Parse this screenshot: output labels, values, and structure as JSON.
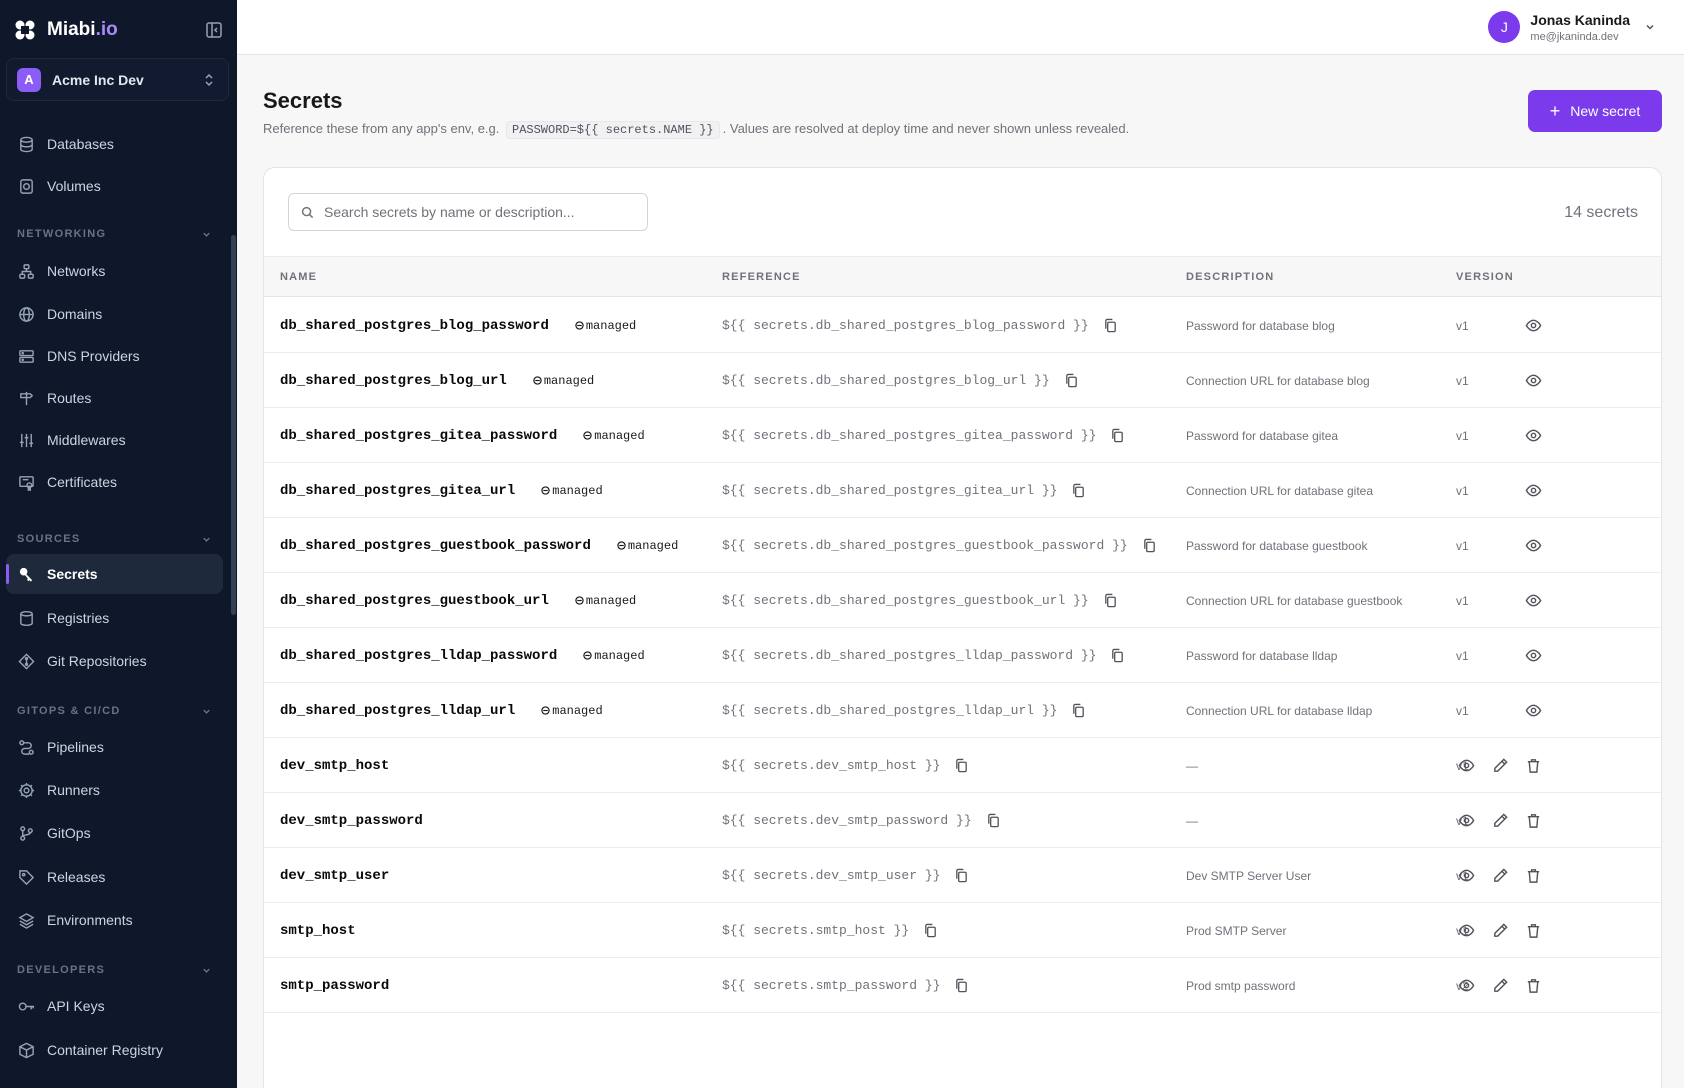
{
  "brand": {
    "name": "Miabi",
    "tld": ".io"
  },
  "org": {
    "initial": "A",
    "name": "Acme Inc Dev"
  },
  "sidebar": {
    "storage": [
      {
        "label": "Databases",
        "icon": "database-icon"
      },
      {
        "label": "Volumes",
        "icon": "volume-icon"
      }
    ],
    "sections": [
      {
        "title": "NETWORKING",
        "items": [
          {
            "label": "Networks",
            "icon": "network-icon"
          },
          {
            "label": "Domains",
            "icon": "globe-icon"
          },
          {
            "label": "DNS Providers",
            "icon": "server-icon"
          },
          {
            "label": "Routes",
            "icon": "signpost-icon"
          },
          {
            "label": "Middlewares",
            "icon": "sliders-icon"
          },
          {
            "label": "Certificates",
            "icon": "certificate-icon"
          }
        ]
      },
      {
        "title": "SOURCES",
        "items": [
          {
            "label": "Secrets",
            "icon": "key-icon",
            "active": true
          },
          {
            "label": "Registries",
            "icon": "registry-icon"
          },
          {
            "label": "Git Repositories",
            "icon": "git-icon"
          }
        ]
      },
      {
        "title": "GITOPS & CI/CD",
        "items": [
          {
            "label": "Pipelines",
            "icon": "pipeline-icon"
          },
          {
            "label": "Runners",
            "icon": "cog-icon"
          },
          {
            "label": "GitOps",
            "icon": "git-branch-icon"
          },
          {
            "label": "Releases",
            "icon": "tag-icon"
          },
          {
            "label": "Environments",
            "icon": "layers-icon"
          }
        ]
      },
      {
        "title": "DEVELOPERS",
        "items": [
          {
            "label": "API Keys",
            "icon": "key-round-icon"
          },
          {
            "label": "Container Registry",
            "icon": "box-icon"
          }
        ]
      }
    ]
  },
  "user": {
    "initial": "J",
    "name": "Jonas Kaninda",
    "email": "me@jkaninda.dev"
  },
  "page": {
    "title": "Secrets",
    "subtitle_before": "Reference these from any app's env, e.g.",
    "subtitle_code": "PASSWORD=${{ secrets.NAME }}",
    "subtitle_after": ". Values are resolved at deploy time and never shown unless revealed.",
    "new_button": "New secret"
  },
  "search": {
    "placeholder": "Search secrets by name or description..."
  },
  "count": "14 secrets",
  "table": {
    "headers": {
      "name": "NAME",
      "reference": "REFERENCE",
      "description": "DESCRIPTION",
      "version": "VERSION"
    },
    "badge_label": "managed",
    "rows": [
      {
        "name": "db_shared_postgres_blog_password",
        "managed": true,
        "reference": "${{ secrets.db_shared_postgres_blog_password }}",
        "description": "Password for database blog",
        "version": "v1"
      },
      {
        "name": "db_shared_postgres_blog_url",
        "managed": true,
        "reference": "${{ secrets.db_shared_postgres_blog_url }}",
        "description": "Connection URL for database blog",
        "version": "v1"
      },
      {
        "name": "db_shared_postgres_gitea_password",
        "managed": true,
        "reference": "${{ secrets.db_shared_postgres_gitea_password }}",
        "description": "Password for database gitea",
        "version": "v1"
      },
      {
        "name": "db_shared_postgres_gitea_url",
        "managed": true,
        "reference": "${{ secrets.db_shared_postgres_gitea_url }}",
        "description": "Connection URL for database gitea",
        "version": "v1"
      },
      {
        "name": "db_shared_postgres_guestbook_password",
        "managed": true,
        "reference": "${{ secrets.db_shared_postgres_guestbook_password }}",
        "description": "Password for database guestbook",
        "version": "v1"
      },
      {
        "name": "db_shared_postgres_guestbook_url",
        "managed": true,
        "reference": "${{ secrets.db_shared_postgres_guestbook_url }}",
        "description": "Connection URL for database guestbook",
        "version": "v1"
      },
      {
        "name": "db_shared_postgres_lldap_password",
        "managed": true,
        "reference": "${{ secrets.db_shared_postgres_lldap_password }}",
        "description": "Password for database lldap",
        "version": "v1"
      },
      {
        "name": "db_shared_postgres_lldap_url",
        "managed": true,
        "reference": "${{ secrets.db_shared_postgres_lldap_url }}",
        "description": "Connection URL for database lldap",
        "version": "v1"
      },
      {
        "name": "dev_smtp_host",
        "managed": false,
        "reference": "${{ secrets.dev_smtp_host }}",
        "description": "—",
        "version": "v1"
      },
      {
        "name": "dev_smtp_password",
        "managed": false,
        "reference": "${{ secrets.dev_smtp_password }}",
        "description": "—",
        "version": "v1"
      },
      {
        "name": "dev_smtp_user",
        "managed": false,
        "reference": "${{ secrets.dev_smtp_user }}",
        "description": "Dev SMTP Server User",
        "version": "v1"
      },
      {
        "name": "smtp_host",
        "managed": false,
        "reference": "${{ secrets.smtp_host }}",
        "description": "Prod SMTP Server",
        "version": "v1"
      },
      {
        "name": "smtp_password",
        "managed": false,
        "reference": "${{ secrets.smtp_password }}",
        "description": "Prod smtp password",
        "version": "v2"
      }
    ]
  },
  "colors": {
    "accent": "#7c3aed",
    "sidebar_bg": "#0f172a",
    "page_bg": "#f7f7f8"
  }
}
